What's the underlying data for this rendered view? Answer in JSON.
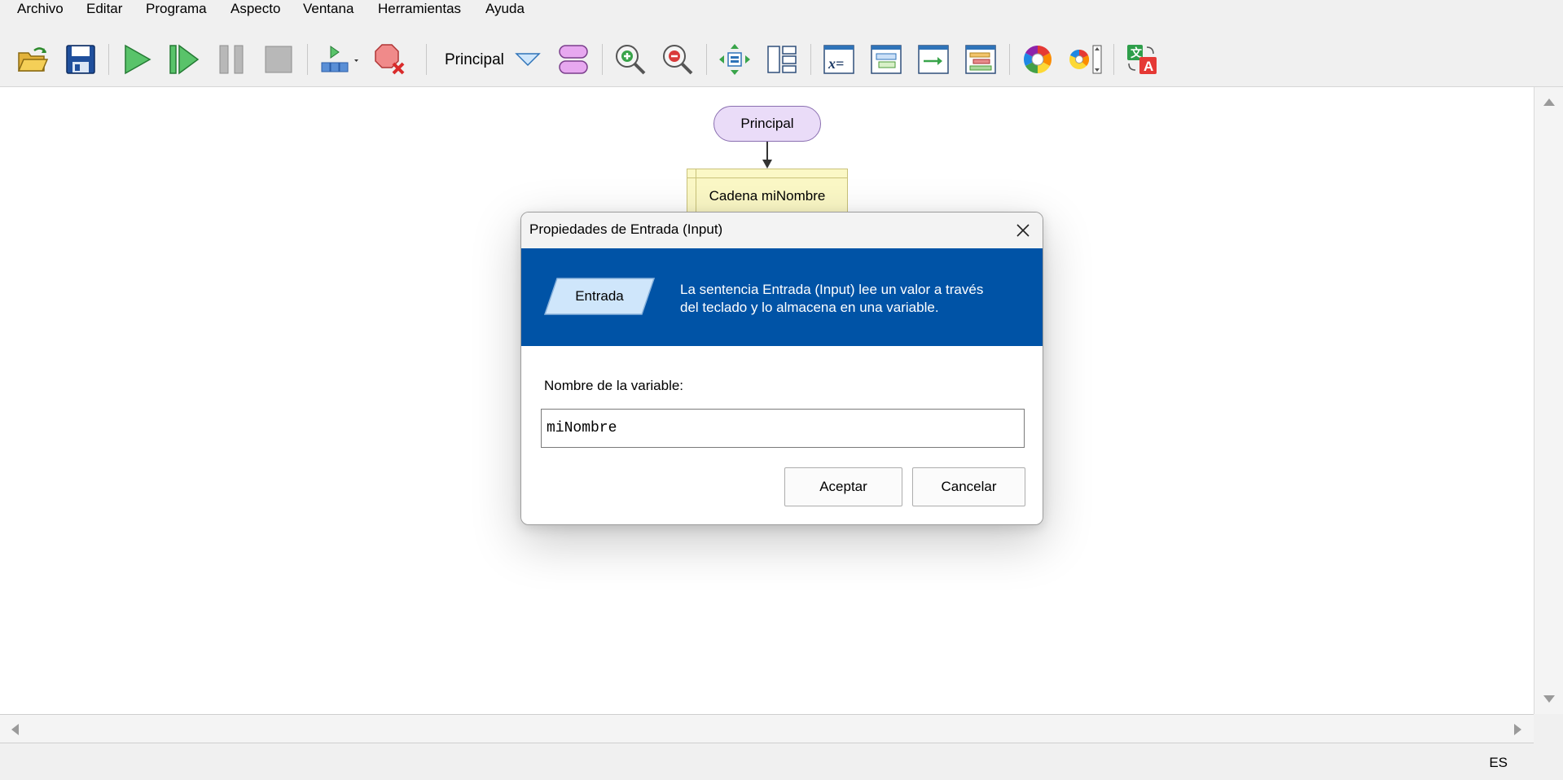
{
  "menu": [
    "Archivo",
    "Editar",
    "Programa",
    "Aspecto",
    "Ventana",
    "Herramientas",
    "Ayuda"
  ],
  "toolbar": {
    "subchart_label": "Principal",
    "icons": [
      "open-icon",
      "save-icon",
      "run-icon",
      "step-icon",
      "pause-icon",
      "stop-icon",
      "run-menu-icon",
      "clear-breakpoints-icon",
      "subchart-dropdown-icon",
      "add-subchart-icon",
      "zoom-in-icon",
      "zoom-out-icon",
      "fit-icon",
      "layout-icon",
      "variables-window-icon",
      "program-window-icon",
      "output-window-icon",
      "breakpoint-window-icon",
      "color-icon",
      "theme-icon",
      "translate-icon"
    ]
  },
  "flowchart": {
    "start_label": "Principal",
    "declare_label": "Cadena miNombre"
  },
  "dialog": {
    "title": "Propiedades de Entrada (Input)",
    "shape_label": "Entrada",
    "description_line1": "La sentencia Entrada (Input) lee un valor a través",
    "description_line2": "del teclado y lo almacena en una variable.",
    "field_label": "Nombre de la variable:",
    "field_value": "miNombre",
    "ok_label": "Aceptar",
    "cancel_label": "Cancelar"
  },
  "colors": {
    "banner": "#0053a6",
    "start_node_fill": "#eadcf8",
    "declare_node_fill": "#fbf8c6"
  },
  "status": {
    "language": "ES"
  }
}
